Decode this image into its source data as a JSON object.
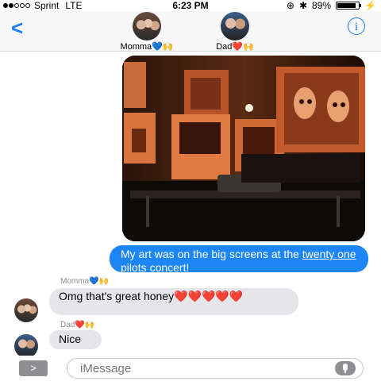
{
  "status_bar": {
    "carrier": "Sprint",
    "network": "LTE",
    "time": "6:23 PM",
    "battery": "89%",
    "battery_level": 0.89
  },
  "header": {
    "contacts": [
      {
        "name": "Momma💙🙌"
      },
      {
        "name": "Dad❤️🙌"
      }
    ]
  },
  "messages": [
    {
      "type": "image",
      "direction": "outgoing"
    },
    {
      "type": "text",
      "direction": "outgoing",
      "text_before": "My art was on the big screens at the ",
      "link_text": "twenty one pilots",
      "text_after": " concert!"
    },
    {
      "type": "text",
      "direction": "incoming",
      "sender": "Momma💙🙌",
      "text": "Omg that's great honey❤️❤️❤️❤️❤️"
    },
    {
      "type": "text",
      "direction": "incoming",
      "sender": "Dad❤️🙌",
      "text": "Nice"
    }
  ],
  "composer": {
    "placeholder": "iMessage"
  },
  "colors": {
    "accent": "#1a7cf5",
    "outgoing_bubble": "#1c86f7",
    "incoming_bubble": "#e5e5ea"
  }
}
